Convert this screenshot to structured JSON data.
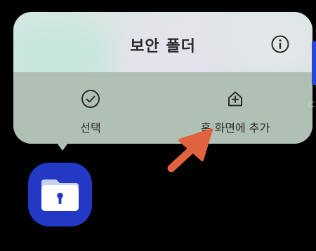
{
  "popup": {
    "title": "보안 폴더",
    "info_icon": "info-icon",
    "actions": [
      {
        "label": "선택",
        "icon": "check-circle-icon"
      },
      {
        "label": "홈 화면에 추가",
        "icon": "add-home-icon"
      }
    ]
  },
  "edge_label": "ㄷ",
  "colors": {
    "background": "#000000",
    "actions_bar": "#b1c0b4",
    "arrow": "#e0623f",
    "app_icon": "#2239c5"
  },
  "app_icon": "secure-folder-icon"
}
